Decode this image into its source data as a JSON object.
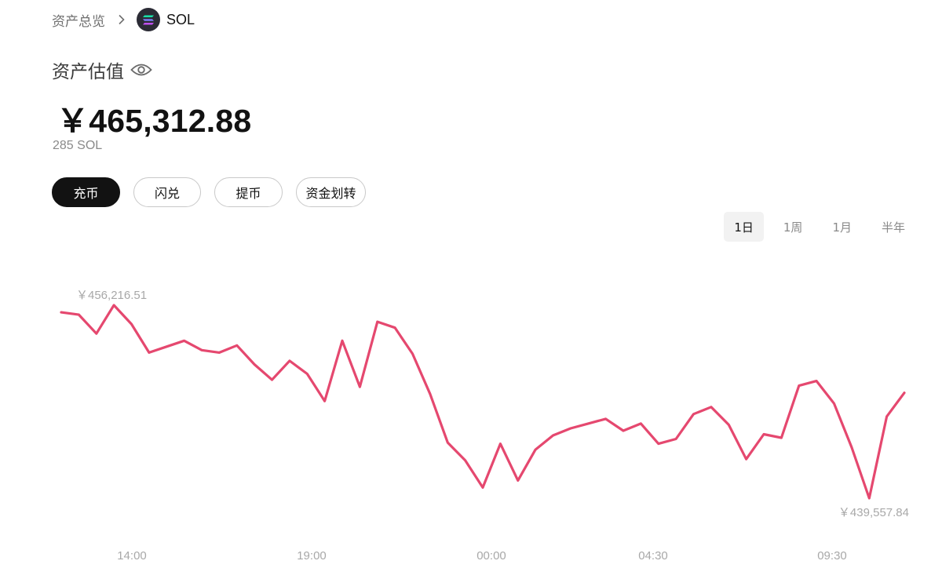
{
  "breadcrumb": {
    "parent": "资产总览",
    "current": "SOL",
    "coin_icon": "solana-logo"
  },
  "valuation": {
    "label": "资产估值",
    "visibility_icon": "eye-icon",
    "amount": "￥465,312.88",
    "quantity": "285 SOL"
  },
  "actions": {
    "deposit": "充币",
    "swap": "闪兑",
    "withdraw": "提币",
    "transfer": "资金划转"
  },
  "range_tabs": {
    "items": [
      "1日",
      "1周",
      "1月",
      "半年"
    ],
    "active": "1日"
  },
  "colors": {
    "line": "#e5486f",
    "primary_button": "#121212"
  },
  "chart_data": {
    "type": "line",
    "x_ticks": [
      "14:00",
      "19:00",
      "00:00",
      "04:30",
      "09:30"
    ],
    "annotations": {
      "max_label": "￥456,216.51",
      "min_label": "￥439,557.84"
    },
    "values": [
      456000,
      455800,
      454200,
      456600,
      455000,
      452600,
      453100,
      453600,
      452800,
      452600,
      453200,
      451600,
      450300,
      451900,
      450800,
      448500,
      453600,
      449700,
      455200,
      454700,
      452500,
      449100,
      445000,
      443500,
      441200,
      444900,
      441800,
      444400,
      445600,
      446200,
      446600,
      447000,
      446000,
      446600,
      444900,
      445300,
      447400,
      448000,
      446500,
      443600,
      445700,
      445400,
      449800,
      450200,
      448300,
      444600,
      440300,
      447200,
      449200
    ]
  }
}
